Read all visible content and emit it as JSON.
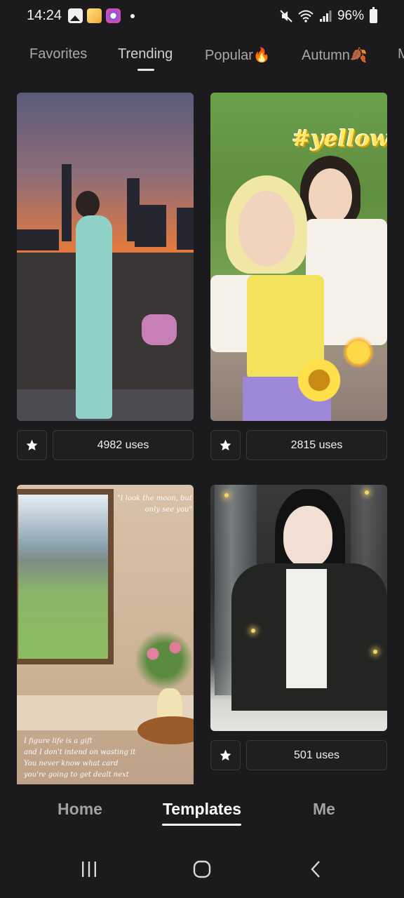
{
  "status_bar": {
    "time": "14:24",
    "battery": "96%",
    "left_icons": [
      "gallery-icon",
      "app-icon",
      "camera-app-icon",
      "notification-dot"
    ],
    "right_icons": [
      "mute-icon",
      "wifi-icon",
      "signal-icon",
      "battery-icon"
    ]
  },
  "category_tabs": {
    "items": [
      {
        "label": "Favorites"
      },
      {
        "label": "Trending",
        "active": true
      },
      {
        "label": "Popular🔥"
      },
      {
        "label": "Autumn🍂"
      },
      {
        "label": "M"
      }
    ]
  },
  "templates": [
    {
      "uses": "4982 uses",
      "thumbnail": "woman-at-sunset-skyline"
    },
    {
      "uses": "2815 uses",
      "thumbnail": "yellow-selfie",
      "sticker_text": "#yellow"
    },
    {
      "uses": "",
      "thumbnail": "window-with-flowers",
      "script_lines": [
        "\"I look the moon, but only see you\"",
        "I figure life is a gift",
        "and I don't intend on wasting it",
        "You never know what card",
        "you're going to get dealt next"
      ]
    },
    {
      "uses": "501 uses",
      "thumbnail": "woman-in-hanfu"
    }
  ],
  "bottom_nav": {
    "items": [
      {
        "label": "Home"
      },
      {
        "label": "Templates",
        "active": true
      },
      {
        "label": "Me"
      }
    ]
  },
  "system_nav": [
    "recents-button",
    "home-button",
    "back-button"
  ],
  "colors": {
    "background": "#1b1b1d",
    "button_border": "#39393c",
    "text_primary": "#ffffff",
    "text_secondary": "#a8a8ab"
  }
}
